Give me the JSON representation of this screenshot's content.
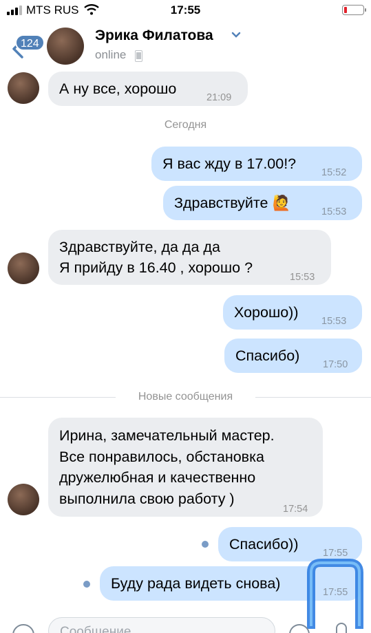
{
  "status_bar": {
    "carrier": "MTS RUS",
    "time": "17:55",
    "battery_level": 0.15,
    "battery_color": "#e2212b"
  },
  "header": {
    "unread_count": "124",
    "name": "Эрика Филатова",
    "status": "online",
    "icons": [
      "back-arrow-icon",
      "chevron-down-icon",
      "mobile-phone-icon"
    ]
  },
  "conversation": {
    "date_separator": "Сегодня",
    "new_messages_separator": "Новые сообщения",
    "messages": [
      {
        "dir": "in",
        "text": "А ну все, хорошо",
        "time": "21:09"
      },
      {
        "dir": "out",
        "text": "Я вас жду в 17.00!?",
        "time": "15:52"
      },
      {
        "dir": "out",
        "text": "Здравствуйте 🙋",
        "time": "15:53"
      },
      {
        "dir": "in",
        "text": "Здравствуйте, да да да\nЯ прийду в 16.40 , хорошо ?",
        "time": "15:53"
      },
      {
        "dir": "out",
        "text": "Хорошо))",
        "time": "15:53"
      },
      {
        "dir": "out",
        "text": "Спасибо)",
        "time": "17:50"
      },
      {
        "dir": "in",
        "text": "Ирина, замечательный мастер.\nВсе понравилось, обстановка\nдружелюбная и качественно\nвыполнила свою работу )",
        "time": "17:54"
      },
      {
        "dir": "out",
        "text": "Спасибо))",
        "time": "17:55",
        "unread": true
      },
      {
        "dir": "out",
        "text": "Буду рада видеть снова)",
        "time": "17:55",
        "unread": true
      }
    ]
  },
  "input": {
    "placeholder": "Сообщение"
  },
  "colors": {
    "accent": "#5181b8",
    "incoming_bubble": "#ebedf0",
    "outgoing_bubble": "#cce4ff"
  }
}
